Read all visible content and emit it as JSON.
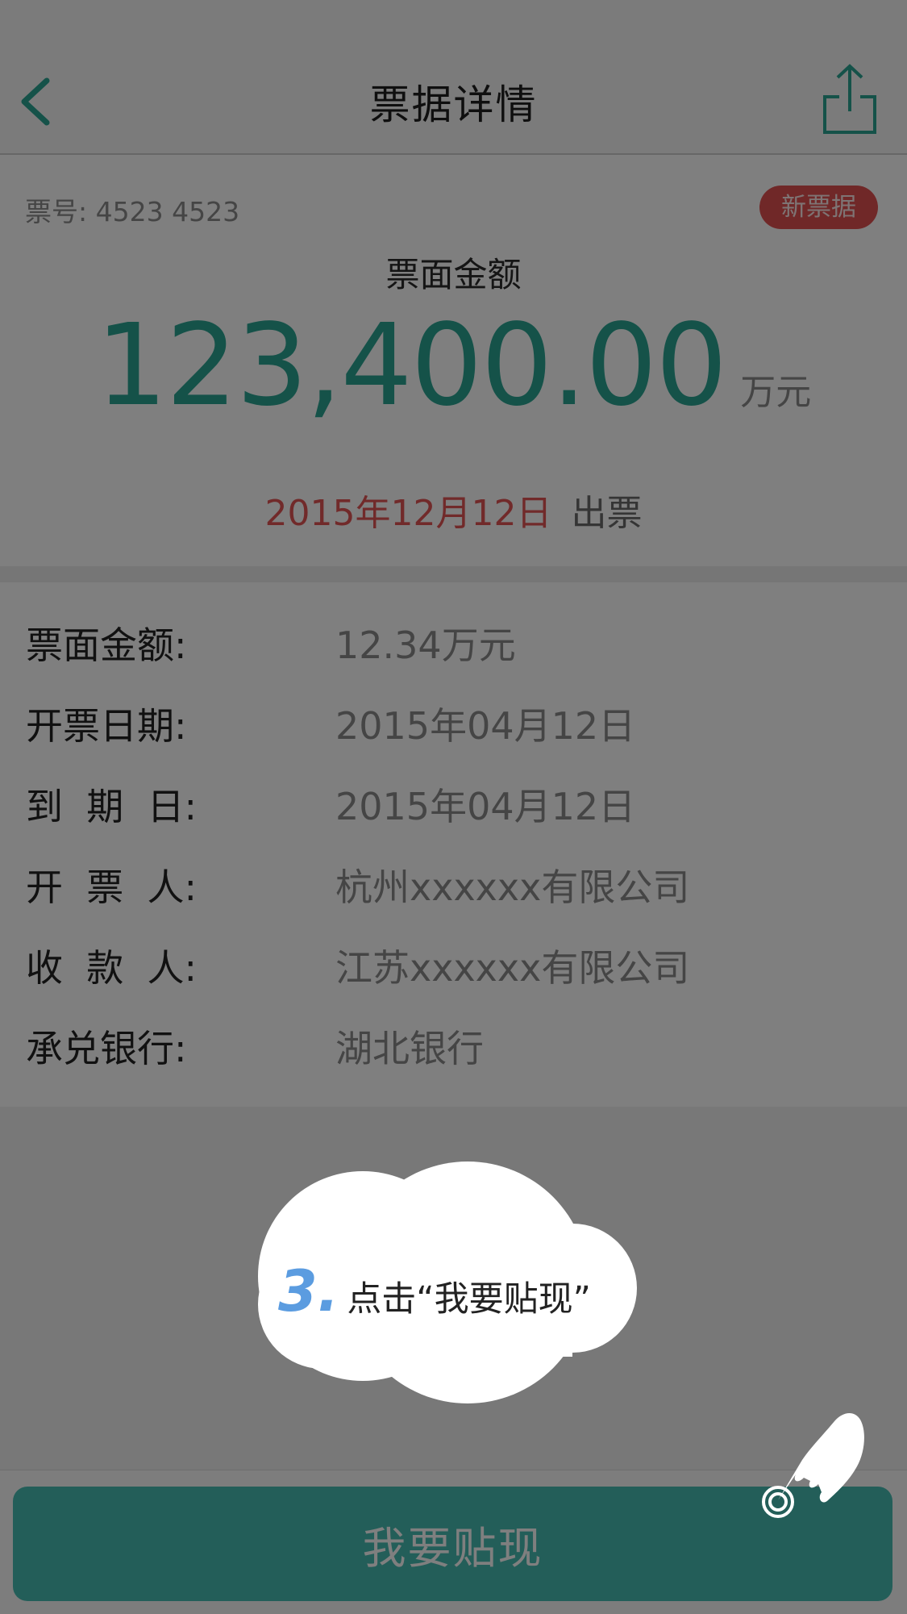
{
  "header": {
    "title": "票据详情"
  },
  "summary": {
    "ticket_no": "票号: 4523 4523",
    "badge": "新票据",
    "face_label": "票面金额",
    "amount": "123,400.00",
    "amount_unit": "万元",
    "issue_date": "2015年12月12日",
    "issue_suffix": "出票"
  },
  "details": [
    {
      "label": "票面金额:",
      "value": "12.34万元"
    },
    {
      "label": "开票日期:",
      "value": "2015年04月12日"
    },
    {
      "label": "到  期  日:",
      "value": "2015年04月12日"
    },
    {
      "label": "开  票  人:",
      "value": "杭州xxxxxx有限公司"
    },
    {
      "label": "收  款  人:",
      "value": "江苏xxxxxx有限公司"
    },
    {
      "label": "承兑银行:",
      "value": "湖北银行"
    }
  ],
  "tutorial": {
    "step_number": "3.",
    "step_text": "点击“我要贴现”"
  },
  "footer": {
    "button_label": "我要贴现"
  },
  "colors": {
    "accent": "#2aa493",
    "button": "#46bdb2",
    "badge": "#e15050",
    "date_red": "#e35555"
  },
  "icons": [
    "back-arrow-icon",
    "share-icon",
    "pointing-hand-icon"
  ]
}
